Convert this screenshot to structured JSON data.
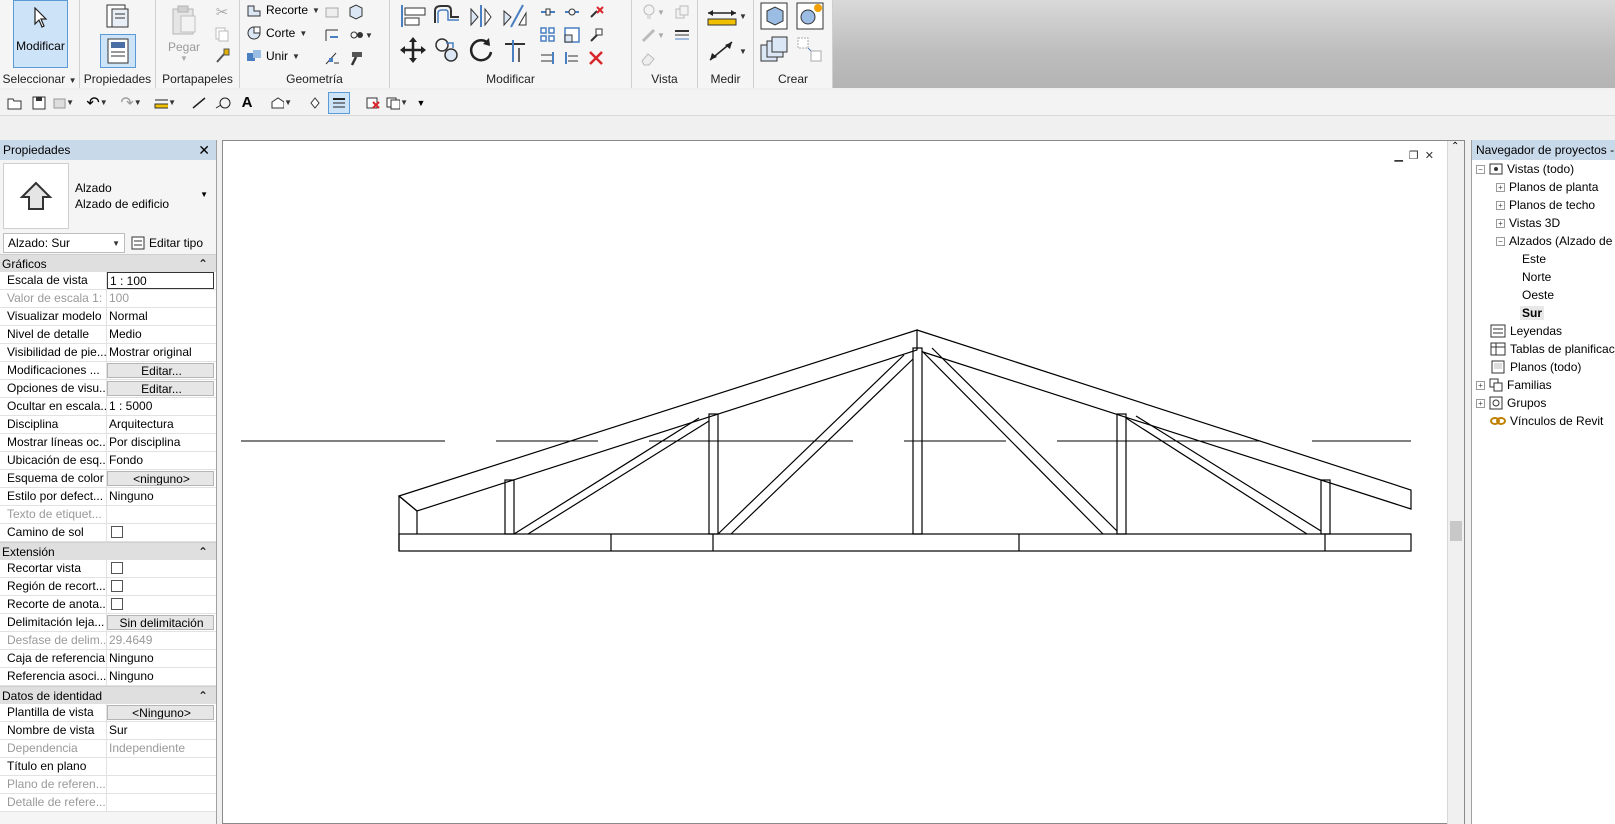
{
  "ribbon": {
    "modify_label": "Modificar",
    "panels": {
      "select": "Seleccionar",
      "properties": "Propiedades",
      "clipboard": "Portapapeles",
      "geometry": "Geometría",
      "modify": "Modificar",
      "view": "Vista",
      "measure": "Medir",
      "create": "Crear"
    },
    "paste_label": "Pegar",
    "geometry_items": [
      "Recorte",
      "Corte",
      "Unir"
    ]
  },
  "properties": {
    "title": "Propiedades",
    "type_line1": "Alzado",
    "type_line2": "Alzado de edificio",
    "selector": "Alzado: Sur",
    "edit_type": "Editar tipo",
    "groups": {
      "graphics": "Gráficos",
      "extents": "Extensión",
      "identity": "Datos de identidad"
    },
    "graphics_rows": [
      {
        "k": "Escala de vista",
        "v": "1 : 100"
      },
      {
        "k": "Valor de escala    1:",
        "v": "100"
      },
      {
        "k": "Visualizar modelo",
        "v": "Normal"
      },
      {
        "k": "Nivel de detalle",
        "v": "Medio"
      },
      {
        "k": "Visibilidad de pie...",
        "v": "Mostrar original"
      },
      {
        "k": "Modificaciones ...",
        "v": "Editar..."
      },
      {
        "k": "Opciones de visu...",
        "v": "Editar..."
      },
      {
        "k": "Ocultar en escala...",
        "v": "1 : 5000"
      },
      {
        "k": "Disciplina",
        "v": "Arquitectura"
      },
      {
        "k": "Mostrar líneas oc...",
        "v": "Por disciplina"
      },
      {
        "k": "Ubicación de esq...",
        "v": "Fondo"
      },
      {
        "k": "Esquema de color",
        "v": "<ninguno>"
      },
      {
        "k": "Estilo por defect...",
        "v": "Ninguno"
      },
      {
        "k": "Texto de etiquet...",
        "v": ""
      },
      {
        "k": "Camino de sol",
        "v": ""
      }
    ],
    "extents_rows": [
      {
        "k": "Recortar vista",
        "v": ""
      },
      {
        "k": "Región de recort...",
        "v": ""
      },
      {
        "k": "Recorte de anota...",
        "v": ""
      },
      {
        "k": "Delimitación leja...",
        "v": "Sin delimitación"
      },
      {
        "k": "Desfase de delim...",
        "v": "29.4649"
      },
      {
        "k": "Caja de referencia",
        "v": "Ninguno"
      },
      {
        "k": "Referencia asoci...",
        "v": "Ninguno"
      }
    ],
    "identity_rows": [
      {
        "k": "Plantilla de vista",
        "v": "<Ninguno>"
      },
      {
        "k": "Nombre de vista",
        "v": "Sur"
      },
      {
        "k": "Dependencia",
        "v": "Independiente"
      },
      {
        "k": "Título en plano",
        "v": ""
      },
      {
        "k": "Plano de referen...",
        "v": ""
      },
      {
        "k": "Detalle de refere...",
        "v": ""
      }
    ]
  },
  "browser": {
    "title": "Navegador de proyectos - P",
    "items": [
      "Vistas (todo)",
      "Planos de planta",
      "Planos de techo",
      "Vistas 3D",
      "Alzados (Alzado de",
      "Este",
      "Norte",
      "Oeste",
      "Sur",
      "Leyendas",
      "Tablas de planificac",
      "Planos (todo)",
      "Familias",
      "Grupos",
      "Vínculos de Revit"
    ]
  },
  "colors": {
    "accent": "#5b9bd5",
    "panel_title": "#c8d9ea",
    "group_header": "#dfdfdf",
    "delete_red": "#d9262a"
  }
}
